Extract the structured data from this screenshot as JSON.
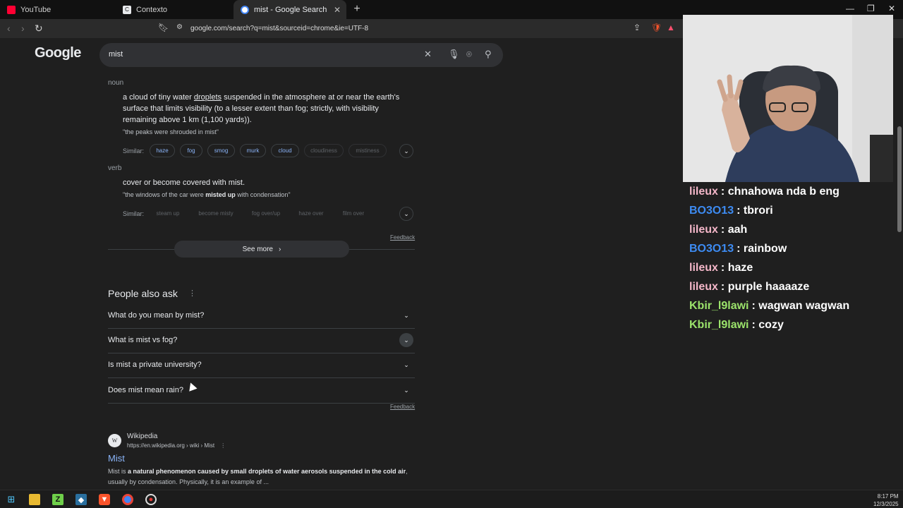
{
  "browser": {
    "tabs": [
      {
        "label": "YouTube",
        "favicon_color": "#ff0033"
      },
      {
        "label": "Contexto",
        "favicon_color": "#e8eaed"
      },
      {
        "label": "mist - Google Search",
        "favicon_color": "#4285f4"
      }
    ],
    "url": "google.com/search?q=mist&sourceid=chrome&ie=UTF-8"
  },
  "search": {
    "logo": "Google",
    "query": "mist"
  },
  "dictionary": {
    "noun": {
      "pos": "noun",
      "definition_pre": "a cloud of tiny water ",
      "definition_link": "droplets",
      "definition_post": " suspended in the atmosphere at or near the earth's surface that limits visibility (to a lesser extent than fog; strictly, with visibility remaining above 1 km (1,100 yards)).",
      "example": "\"the peaks were shrouded in mist\"",
      "similar_label": "Similar:",
      "similar": [
        "haze",
        "fog",
        "smog",
        "murk",
        "cloud",
        "cloudiness",
        "mistiness"
      ]
    },
    "verb": {
      "pos": "verb",
      "definition": "cover or become covered with mist.",
      "example_pre": "\"the windows of the car were ",
      "example_bold": "misted up",
      "example_post": " with condensation\"",
      "similar_label": "Similar:",
      "similar": [
        "steam up",
        "become misty",
        "fog over/up",
        "haze over",
        "film over"
      ]
    },
    "feedback": "Feedback",
    "see_more": "See more"
  },
  "people_also_ask": {
    "title": "People also ask",
    "questions": [
      "What do you mean by mist?",
      "What is mist vs fog?",
      "Is mist a private university?",
      "Does mist mean rain?"
    ],
    "feedback": "Feedback"
  },
  "result": {
    "site": "Wikipedia",
    "icon_letter": "W",
    "cite": "https://en.wikipedia.org › wiki › Mist",
    "title": "Mist",
    "snippet_pre": "Mist is ",
    "snippet_bold": "a natural phenomenon caused by small droplets of water aerosols suspended in the cold air",
    "snippet_post": ", usually by condensation. Physically, it is an example of ..."
  },
  "chat": [
    {
      "user": "lileux",
      "color": "#f3b6c8",
      "msg": "chnahowa nda b eng"
    },
    {
      "user": "BO3O13",
      "color": "#3d8bf2",
      "msg": "tbrori"
    },
    {
      "user": "lileux",
      "color": "#f3b6c8",
      "msg": "aah"
    },
    {
      "user": "BO3O13",
      "color": "#3d8bf2",
      "msg": "rainbow"
    },
    {
      "user": "lileux",
      "color": "#f3b6c8",
      "msg": "haze"
    },
    {
      "user": "lileux",
      "color": "#f3b6c8",
      "msg": "purple haaaaze"
    },
    {
      "user": "Kbir_l9lawi",
      "color": "#9be36b",
      "msg": "wagwan wagwan"
    },
    {
      "user": "Kbir_l9lawi",
      "color": "#9be36b",
      "msg": "cozy"
    }
  ],
  "clock": {
    "time": "8:17 PM",
    "date": "12/3/2025"
  }
}
